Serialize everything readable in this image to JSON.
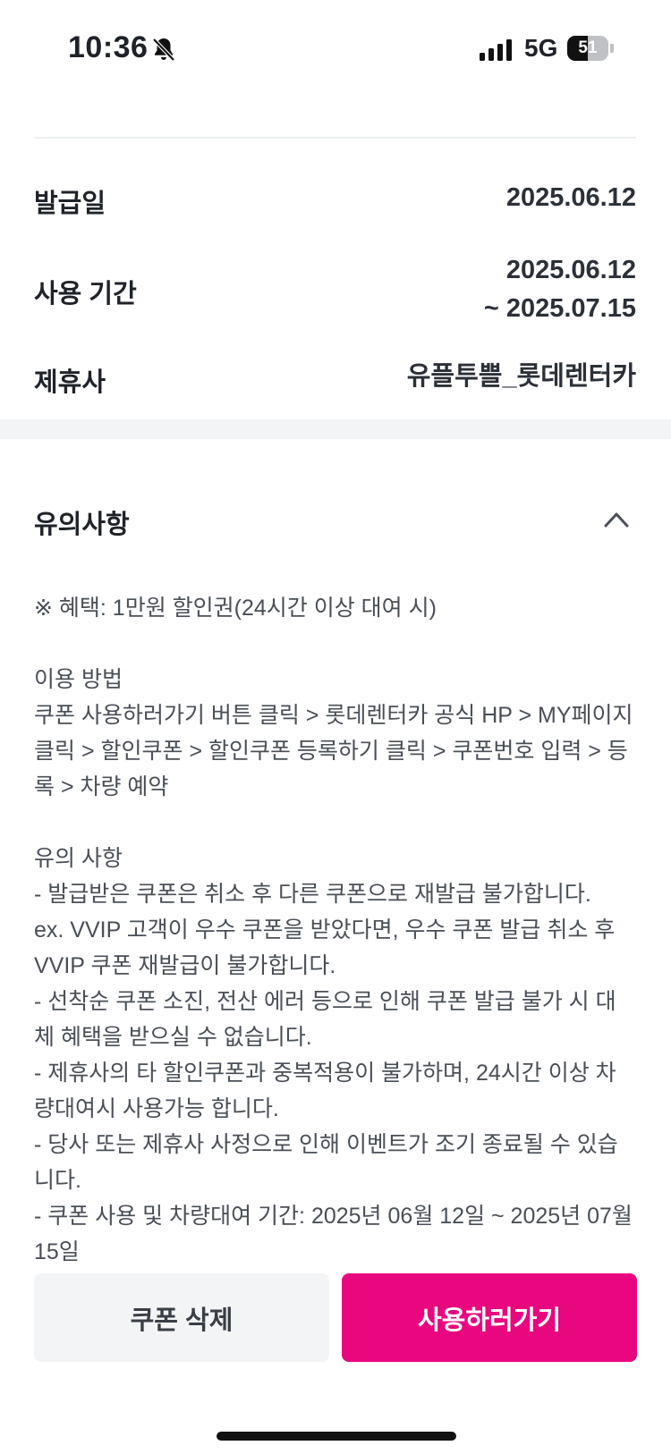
{
  "status_bar": {
    "time": "10:36",
    "network": "5G",
    "battery_level": "51",
    "battery_percent": 51,
    "icons": [
      "bell-slash-icon",
      "signal-icon",
      "battery-icon"
    ]
  },
  "coupon_info": {
    "issue_date_label": "발급일",
    "issue_date": "2025.06.12",
    "period_label": "사용 기간",
    "period_start": "2025.06.12",
    "period_end": "~ 2025.07.15",
    "partner_label": "제휴사",
    "partner": "유플투쁠_롯데렌터카"
  },
  "notice": {
    "title": "유의사항",
    "toggle_icon": "chevron-up-icon",
    "benefit": "※ 혜택: 1만원 할인권(24시간 이상 대여 시)",
    "usage_heading": "이용 방법",
    "usage_text": "쿠폰 사용하러가기 버튼 클릭 > 롯데렌터카 공식 HP > MY페이지 클릭 > 할인쿠폰 > 할인쿠폰 등록하기 클릭 > 쿠폰번호 입력 > 등록 > 차량 예약",
    "caution_heading": "유의 사항",
    "caution_1": "- 발급받은 쿠폰은 취소 후 다른 쿠폰으로 재발급 불가합니다.",
    "caution_2": "ex. VVIP 고객이 우수 쿠폰을 받았다면, 우수 쿠폰 발급 취소 후 VVIP 쿠폰 재발급이 불가합니다.",
    "caution_3": "- 선착순 쿠폰 소진, 전산 에러 등으로 인해 쿠폰 발급 불가 시 대체 혜택을 받으실 수 없습니다.",
    "caution_4": "- 제휴사의 타 할인쿠폰과 중복적용이 불가하며, 24시간 이상 차량대여시 사용가능 합니다.",
    "caution_5": "- 당사 또는 제휴사 사정으로 인해 이벤트가 조기 종료될 수 있습니다.",
    "caution_6": "- 쿠폰 사용 및 차량대여 기간: 2025년 06월 12일 ~ 2025년 07월 15일"
  },
  "actions": {
    "delete_label": "쿠폰 삭제",
    "use_label": "사용하러가기"
  },
  "colors": {
    "accent": "#e8077f",
    "secondary_button_bg": "#f3f4f6",
    "divider": "#eef0f2"
  }
}
